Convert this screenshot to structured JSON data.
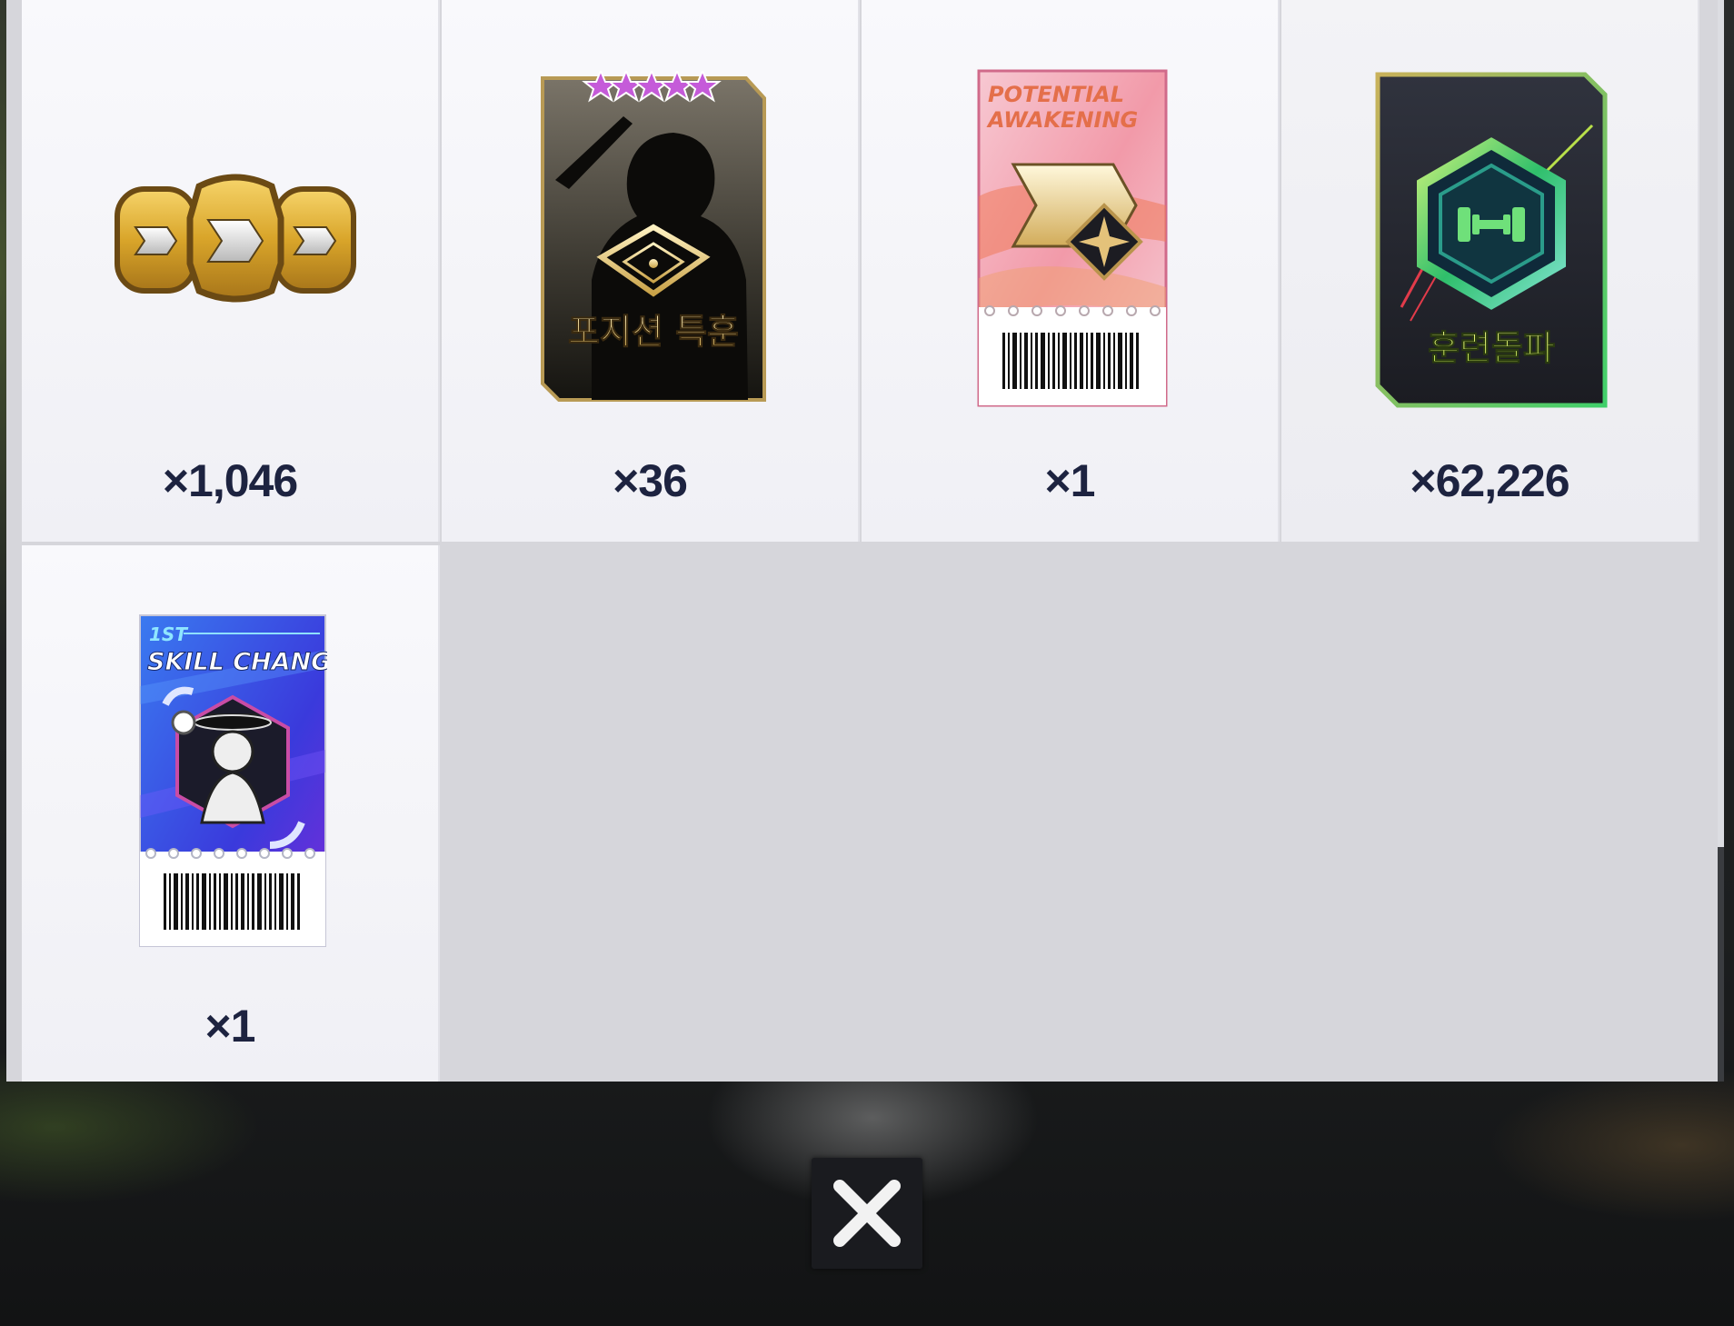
{
  "rewards": [
    {
      "name": "Gold Coins",
      "icon": "gold-coins-icon",
      "quantity": "×1,046"
    },
    {
      "name": "Position Training Card",
      "icon": "position-training-card-icon",
      "card_text": "포지션 특훈",
      "stars": 5,
      "quantity": "×36"
    },
    {
      "name": "Potential Awakening Ticket",
      "icon": "potential-awakening-ticket-icon",
      "card_text_line1": "POTENTIAL",
      "card_text_line2": "AWAKENING",
      "quantity": "×1"
    },
    {
      "name": "Training Breakthrough Card",
      "icon": "training-breakthrough-card-icon",
      "card_text": "훈련돌파",
      "quantity": "×62,226"
    },
    {
      "name": "1st Skill Change Ticket",
      "icon": "skill-change-ticket-icon",
      "card_text_line1": "1ST",
      "card_text_line2": "SKILL CHANGE",
      "quantity": "×1"
    }
  ],
  "close_button": {
    "icon": "close-icon"
  },
  "colors": {
    "quantity_text": "#1d2340",
    "panel_bg": "#d6d6db",
    "cell_bg": "#f5f5f9",
    "close_bg": "#1a1b1f"
  }
}
